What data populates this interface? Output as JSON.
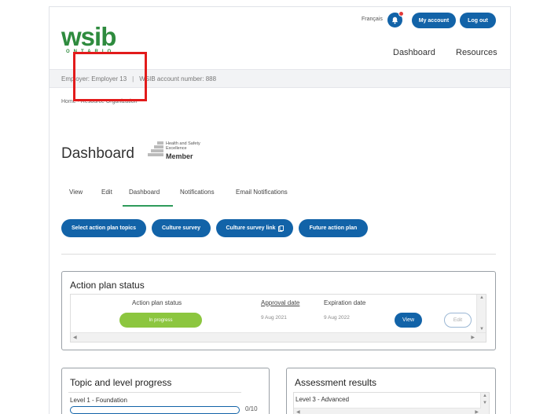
{
  "header": {
    "logo_text": "wsib",
    "logo_sub": "ONTARIO",
    "language": "Français",
    "my_account": "My account",
    "logout": "Log out"
  },
  "nav": {
    "dashboard": "Dashboard",
    "resources": "Resources"
  },
  "account_bar": {
    "employer": "Employer: Employer 13",
    "separator": "|",
    "account_number": "WSIB account number: 888"
  },
  "breadcrumb": "Home · Resource Organization",
  "page": {
    "title": "Dashboard",
    "badge_line1": "Health and Safety",
    "badge_line2": "Excellence",
    "badge_member": "Member"
  },
  "tabs": [
    {
      "label": "View"
    },
    {
      "label": "Edit"
    },
    {
      "label": "Dashboard"
    },
    {
      "label": "Notifications"
    },
    {
      "label": "Email Notifications"
    }
  ],
  "actions": [
    {
      "label": "Select action plan topics"
    },
    {
      "label": "Culture survey"
    },
    {
      "label": "Culture survey link"
    },
    {
      "label": "Future action plan"
    }
  ],
  "action_plan": {
    "title": "Action plan status",
    "col_status": "Action plan status",
    "col_approval": "Approval date",
    "col_expiration": "Expiration date",
    "status": "In progress",
    "approval_date": "9 Aug 2021",
    "expiration_date": "9 Aug 2022",
    "view_label": "View",
    "edit_label": "Edit"
  },
  "topic_progress": {
    "title": "Topic and level progress",
    "level": "Level 1 - Foundation",
    "count": "0/10",
    "progress": 0
  },
  "assessment": {
    "title": "Assessment results",
    "level": "Level 3 - Advanced"
  },
  "colors": {
    "brand_green": "#2e8b3e",
    "primary_blue": "#1263a8",
    "status_green": "#8cc63f",
    "annotation_red": "#e21b1b"
  }
}
